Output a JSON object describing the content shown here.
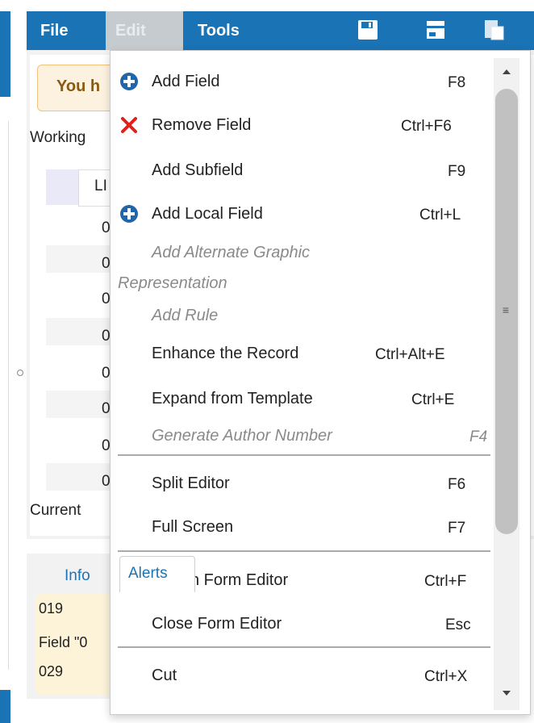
{
  "menubar": {
    "file": "File",
    "edit": "Edit",
    "tools": "Tools",
    "icons": [
      "save-icon",
      "fill-icon",
      "paste-icon"
    ]
  },
  "background": {
    "warning": "You h",
    "working": "Working",
    "ll": "LI",
    "zero": "0",
    "current": "Current",
    "info_tab": "Info",
    "info_lines": [
      "019",
      "Field \"0",
      "029"
    ]
  },
  "menu": {
    "add_field": {
      "label": "Add Field",
      "shortcut": "F8",
      "icon": "plus-circle-icon"
    },
    "remove_field": {
      "label": "Remove Field",
      "shortcut": "Ctrl+F6",
      "icon": "red-x-icon"
    },
    "add_subfield": {
      "label": "Add Subfield",
      "shortcut": "F9"
    },
    "add_local_field": {
      "label": "Add Local Field",
      "shortcut": "Ctrl+L",
      "icon": "plus-circle-icon"
    },
    "add_alternate_line1": "Add Alternate Graphic",
    "add_alternate_line2": "Representation",
    "add_rule": "Add Rule",
    "enhance": {
      "label": "Enhance the Record",
      "shortcut": "Ctrl+Alt+E"
    },
    "expand": {
      "label": "Expand from Template",
      "shortcut": "Ctrl+E"
    },
    "generate_author": {
      "label": "Generate Author Number",
      "shortcut": "F4"
    },
    "split_editor": {
      "label": "Split Editor",
      "shortcut": "F6"
    },
    "full_screen": {
      "label": "Full Screen",
      "shortcut": "F7"
    },
    "form_editor_partial": {
      "label": "n Form Editor",
      "shortcut": "Ctrl+F"
    },
    "close_form_editor": {
      "label": "Close Form Editor",
      "shortcut": "Esc"
    },
    "cut": {
      "label": "Cut",
      "shortcut": "Ctrl+X"
    }
  },
  "alerts_tab": "Alerts",
  "colors": {
    "menubar": "#1a73b5",
    "edit_active": "#c6cbd0",
    "disabled_text": "#8a8a8a",
    "remove_icon": "#e0201c",
    "add_icon": "#2166a8"
  }
}
